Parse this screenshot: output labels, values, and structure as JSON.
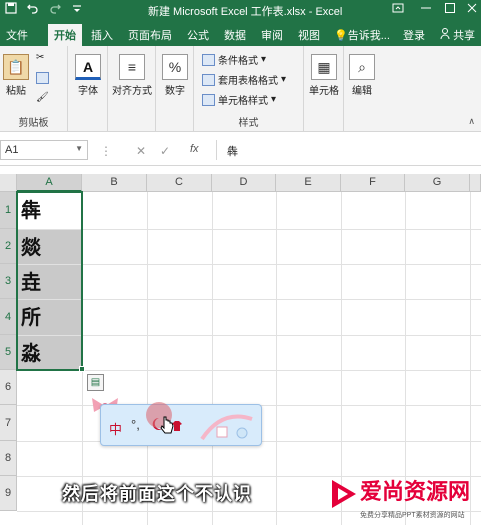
{
  "window": {
    "title": "新建 Microsoft Excel 工作表.xlsx - Excel",
    "qat_icons": [
      "save-icon",
      "undo-icon",
      "redo-icon",
      "customize-icon"
    ],
    "controls": [
      "minimize-icon",
      "maximize-icon",
      "close-icon"
    ]
  },
  "tabs": [
    {
      "label": "文件"
    },
    {
      "label": "开始",
      "active": true
    },
    {
      "label": "插入"
    },
    {
      "label": "页面布局"
    },
    {
      "label": "公式"
    },
    {
      "label": "数据"
    },
    {
      "label": "审阅"
    },
    {
      "label": "视图"
    }
  ],
  "tellme": "告诉我...",
  "signin": "登录",
  "share": "共享",
  "ribbon": {
    "clipboard": {
      "paste": "粘贴",
      "label": "剪贴板"
    },
    "font": {
      "label": "字体"
    },
    "align": {
      "label": "对齐方式"
    },
    "number": {
      "label": "数字"
    },
    "styles": {
      "conditional": "条件格式",
      "table": "套用表格格式",
      "cell": "单元格样式",
      "label": "样式"
    },
    "cells": {
      "label": "单元格"
    },
    "edit": {
      "label": "编辑"
    }
  },
  "formula_bar": {
    "name_box": "A1",
    "cancel": "✕",
    "enter": "✓",
    "fx": "fx",
    "content": "犇"
  },
  "grid": {
    "columns": [
      "A",
      "B",
      "C",
      "D",
      "E",
      "F",
      "G"
    ],
    "rows": [
      "1",
      "2",
      "3",
      "4",
      "5",
      "6",
      "7",
      "8",
      "9"
    ],
    "cells": [
      "犇",
      "燚",
      "垚",
      "所",
      "淼"
    ]
  },
  "ime": {
    "lang": "中",
    "punct": "°,"
  },
  "subtitle": "然后将前面这个不认识",
  "watermark": {
    "title": "爱尚资源网",
    "subtitle": "免费分享精品PPT素材资源的网站"
  },
  "colors": {
    "accent": "#217346",
    "selection_fill": "#c9c9c9"
  }
}
